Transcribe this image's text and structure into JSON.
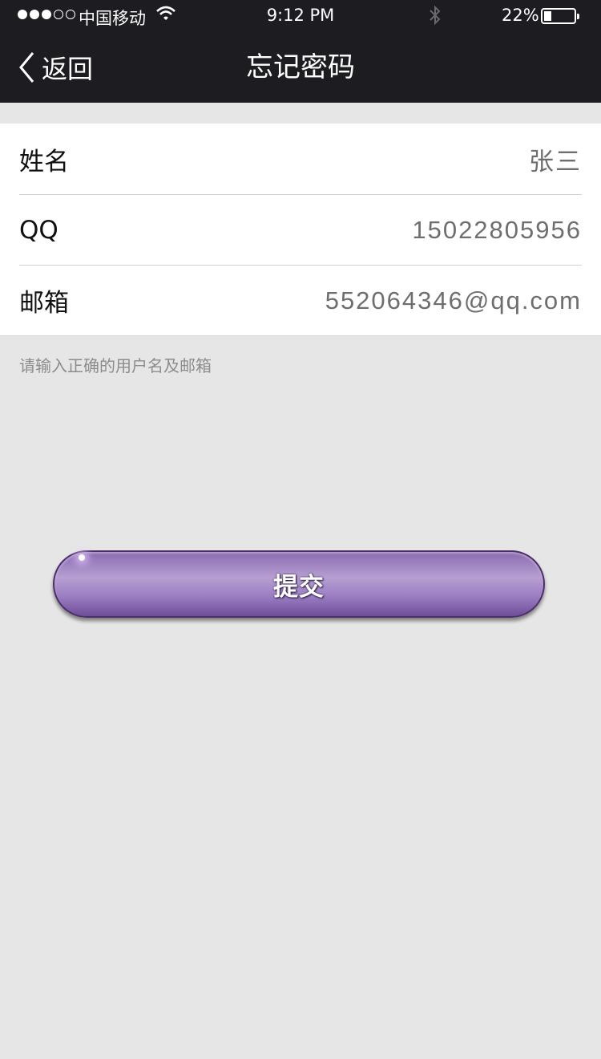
{
  "status_bar": {
    "signal_icon": "signal-dots-icon",
    "carrier": "中国移动",
    "wifi_icon": "wifi-icon",
    "time": "9:12 PM",
    "bluetooth_icon": "bluetooth-icon",
    "battery_percent": "22%",
    "battery_level": 0.22
  },
  "nav": {
    "back_icon": "chevron-left-icon",
    "back_label": "返回",
    "title": "忘记密码"
  },
  "form": {
    "fields": [
      {
        "label": "姓名",
        "value": "张三"
      },
      {
        "label": "QQ",
        "value": "15022805956"
      },
      {
        "label": "邮箱",
        "value": "552064346@qq.com"
      }
    ],
    "hint": "请输入正确的用户名及邮箱"
  },
  "submit": {
    "label": "提交",
    "color": "#9a7cc2"
  },
  "colors": {
    "nav_background": "#1d1c21",
    "page_background": "#e6e6e6"
  }
}
